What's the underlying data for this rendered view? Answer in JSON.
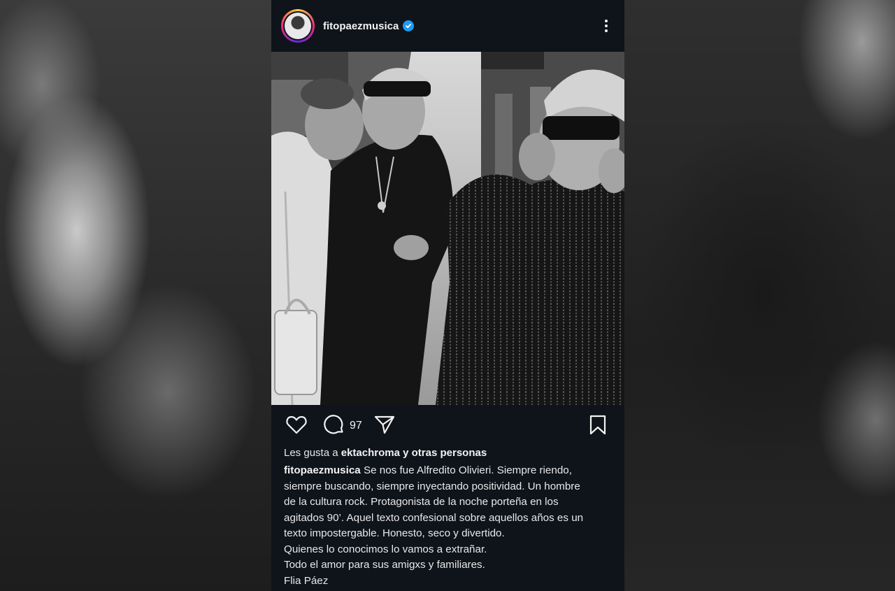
{
  "post": {
    "username": "fitopaezmusica",
    "comment_count": "97",
    "likes": {
      "prefix": "Les gusta a",
      "user": "ektachroma",
      "suffix": "y otras personas"
    },
    "caption": {
      "user": "fitopaezmusica",
      "first_line": "Se nos fue Alfredito Olivieri. Siempre riendo,",
      "lines": [
        "siempre buscando, siempre inyectando positividad. Un hombre",
        "de la cultura rock. Protagonista de la noche porteña en los",
        "agitados 90’. Aquel texto confesional sobre aquellos años es un",
        "texto impostergable. Honesto, seco y divertido.",
        "Quienes lo conocimos lo vamos a extrañar.",
        "Todo el amor para sus amigxs y familiares.",
        "Flia Páez"
      ]
    }
  },
  "icons": {
    "verified": "verified-badge-icon",
    "more": "more-vertical-icon",
    "like": "heart-icon",
    "comment": "comment-icon",
    "share": "send-icon",
    "save": "bookmark-icon"
  },
  "colors": {
    "panel_bg": "#0f131a",
    "verified_blue": "#1d9bf0",
    "text": "#f2f2f2"
  }
}
